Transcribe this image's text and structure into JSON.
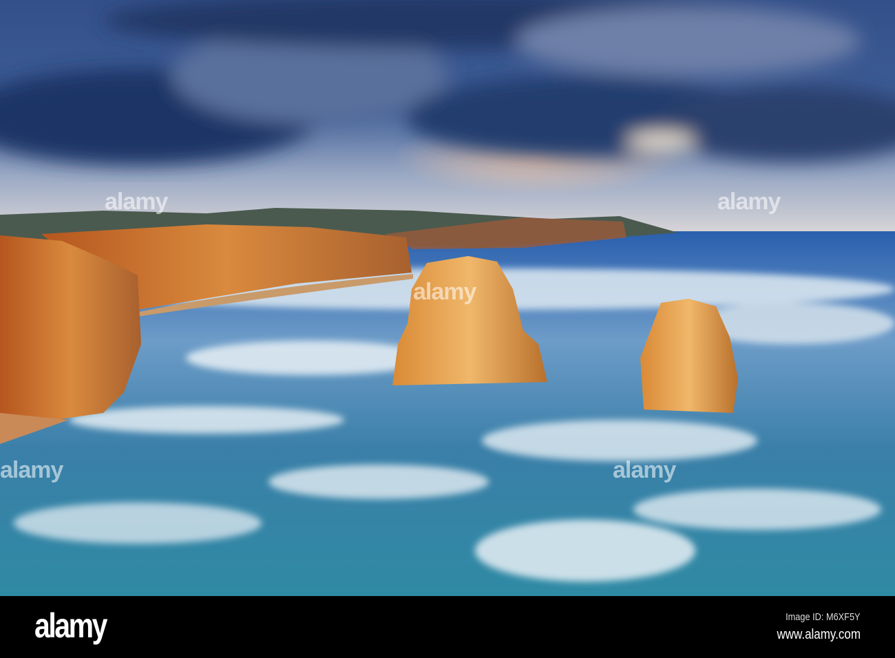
{
  "photo": {
    "subject": "Twelve Apostles limestone stacks on a stormy coastline"
  },
  "watermark": {
    "brand": "alamy"
  },
  "footer": {
    "logo": "alamy",
    "image_id": "Image ID: M6XF5Y",
    "website": "www.alamy.com"
  }
}
